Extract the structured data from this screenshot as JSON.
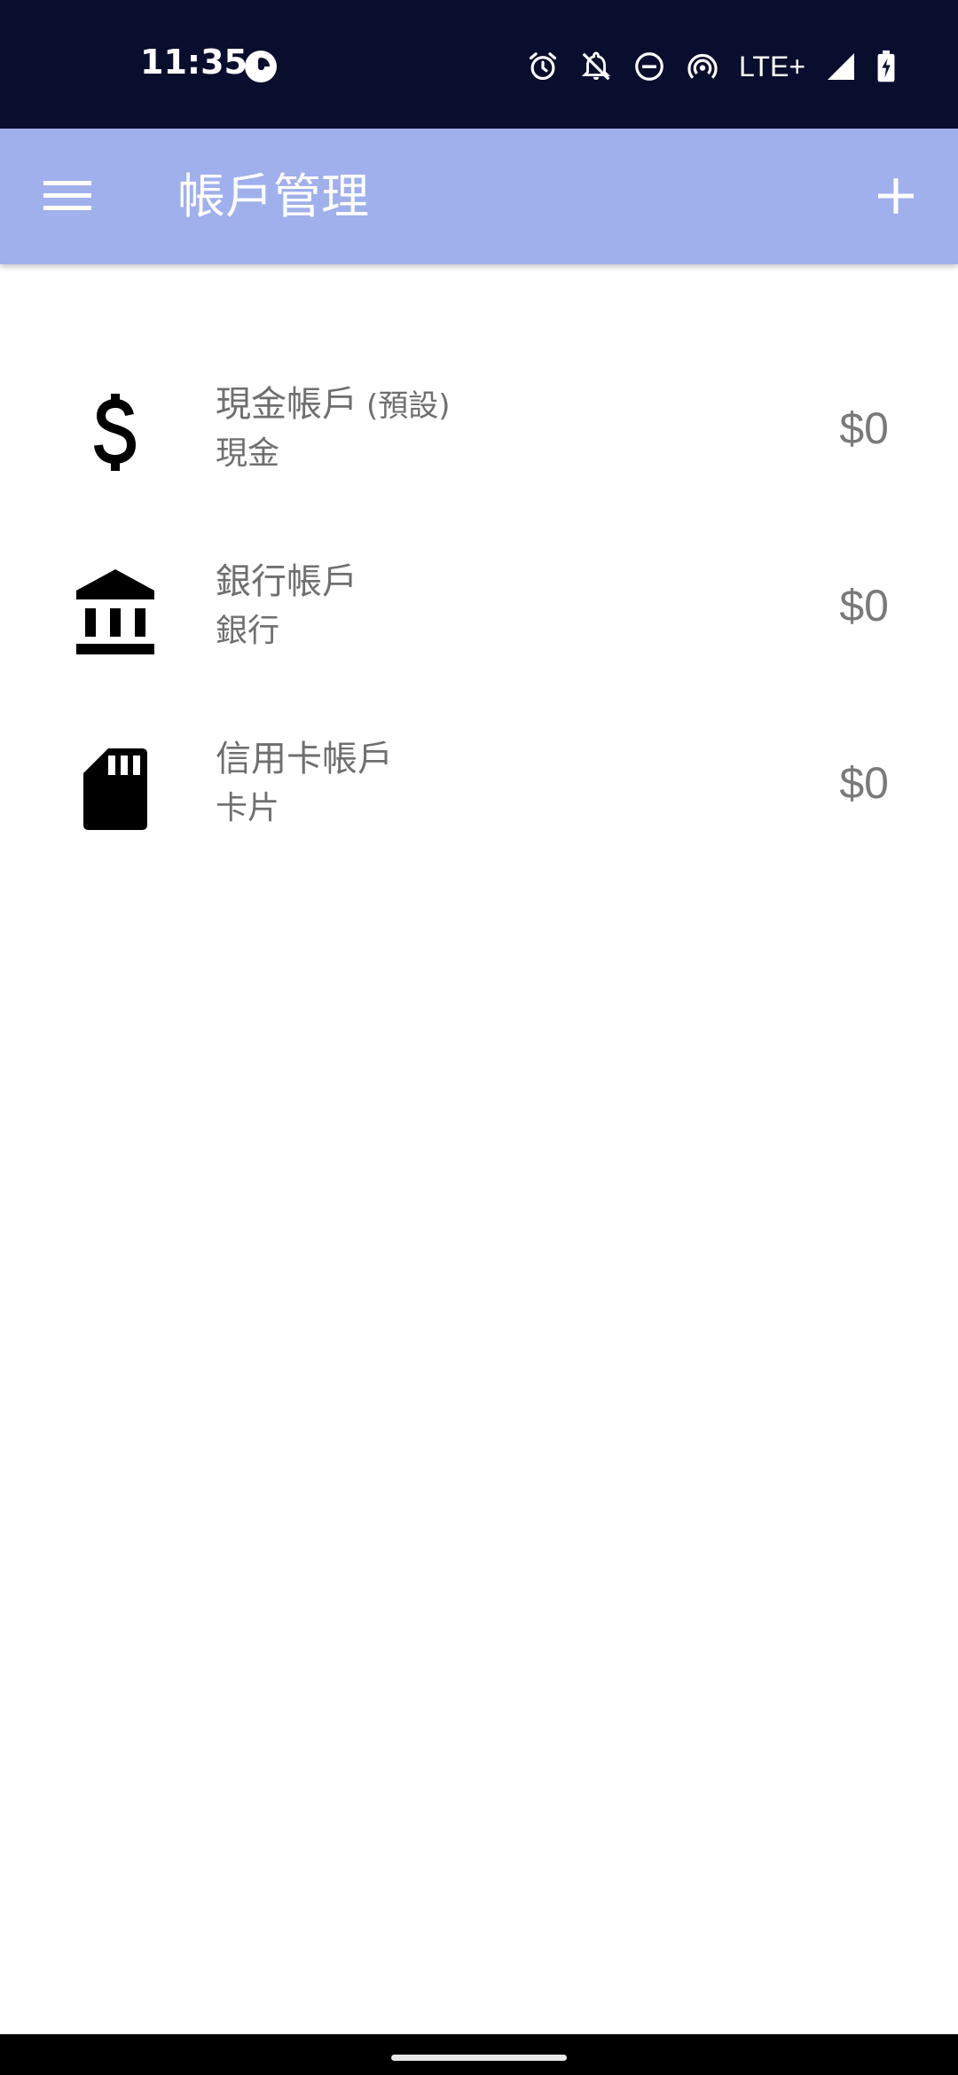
{
  "status_bar": {
    "time": "11:35",
    "network_label": "LTE+",
    "icons": [
      "app-notification-icon",
      "alarm-icon",
      "notifications-off-icon",
      "do-not-disturb-icon",
      "hotspot-icon",
      "signal-icon",
      "battery-charging-icon"
    ]
  },
  "app_bar": {
    "title": "帳戶管理",
    "menu_icon": "menu-icon",
    "add_icon": "add-icon",
    "background_color": "#a0b0ec"
  },
  "accounts": [
    {
      "name": "現金帳戶",
      "tag": "(預設)",
      "type": "現金",
      "balance": "$0",
      "icon": "dollar-icon"
    },
    {
      "name": "銀行帳戶",
      "tag": "",
      "type": "銀行",
      "balance": "$0",
      "icon": "bank-icon"
    },
    {
      "name": "信用卡帳戶",
      "tag": "",
      "type": "卡片",
      "balance": "$0",
      "icon": "card-icon"
    }
  ],
  "colors": {
    "status_bar": "#0a0e2e",
    "text_secondary": "#6f6f6f"
  }
}
